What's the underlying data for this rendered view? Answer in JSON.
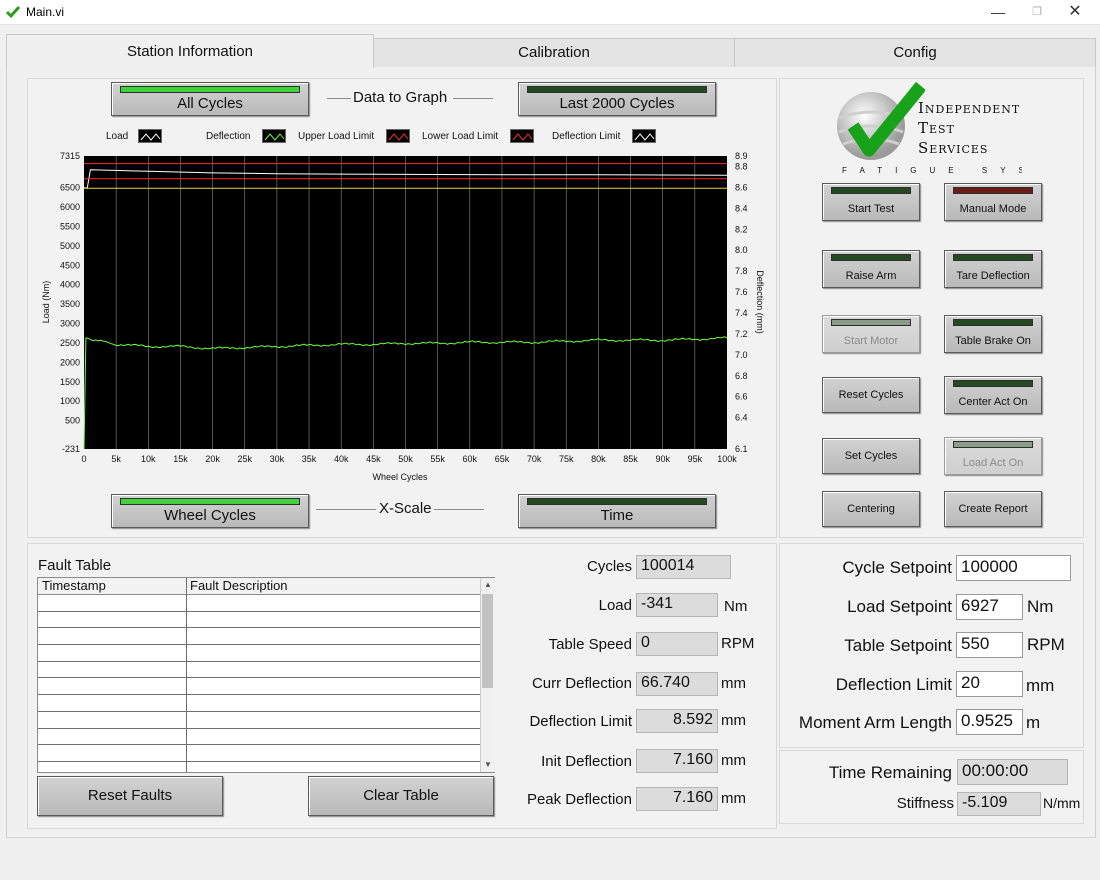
{
  "window": {
    "title": "Main.vi"
  },
  "tabs": [
    "Station Information",
    "Calibration",
    "Config"
  ],
  "graph_controls": {
    "all_cycles": "All Cycles",
    "data_to_graph": "Data to Graph",
    "last_2000": "Last 2000 Cycles",
    "wheel_cycles": "Wheel Cycles",
    "x_scale": "X-Scale",
    "time": "Time"
  },
  "legend": [
    "Load",
    "Deflection",
    "Upper Load Limit",
    "Lower Load Limit",
    "Deflection Limit"
  ],
  "chart_data": {
    "type": "line",
    "xlabel": "Wheel Cycles",
    "ylabel": "Load (Nm)",
    "y2label": "Deflection (mm)",
    "xlim": [
      0,
      100000
    ],
    "ylim": [
      -231,
      7315
    ],
    "y2lim": [
      6.1,
      8.9
    ],
    "x_ticks": [
      "0",
      "5k",
      "10k",
      "15k",
      "20k",
      "25k",
      "30k",
      "35k",
      "40k",
      "45k",
      "50k",
      "55k",
      "60k",
      "65k",
      "70k",
      "75k",
      "80k",
      "85k",
      "90k",
      "95k",
      "100k"
    ],
    "y_ticks": [
      "7315",
      "6500",
      "6000",
      "5500",
      "5000",
      "4500",
      "4000",
      "3500",
      "3000",
      "2500",
      "2000",
      "1500",
      "1000",
      "500",
      "-231"
    ],
    "y2_ticks": [
      "8.9",
      "8.8",
      "8.6",
      "8.4",
      "8.2",
      "8.0",
      "7.8",
      "7.6",
      "7.4",
      "7.2",
      "7.0",
      "6.8",
      "6.6",
      "6.4",
      "6.1"
    ],
    "grid": "vertical",
    "series": [
      {
        "name": "Load",
        "color": "#ffffff",
        "axis": "left",
        "x": [
          0,
          500,
          1000,
          10000,
          20000,
          30000,
          40000,
          50000,
          60000,
          70000,
          80000,
          90000,
          100000
        ],
        "y": [
          6500,
          6480,
          6960,
          6920,
          6880,
          6860,
          6850,
          6840,
          6835,
          6830,
          6830,
          6825,
          6820
        ]
      },
      {
        "name": "Deflection",
        "color": "#6dff3a",
        "axis": "right",
        "x": [
          0,
          300,
          500,
          1000,
          5000,
          10000,
          15000,
          20000,
          25000,
          30000,
          35000,
          40000,
          45000,
          50000,
          55000,
          60000,
          65000,
          70000,
          75000,
          80000,
          85000,
          90000,
          95000,
          100000
        ],
        "y": [
          6.1,
          7.16,
          7.16,
          7.15,
          7.1,
          7.08,
          7.08,
          7.06,
          7.07,
          7.08,
          7.09,
          7.1,
          7.1,
          7.11,
          7.11,
          7.12,
          7.12,
          7.12,
          7.13,
          7.14,
          7.14,
          7.14,
          7.15,
          7.16
        ]
      },
      {
        "name": "Upper Load Limit",
        "color": "#ff2a2a",
        "axis": "left",
        "x": [
          0,
          100000
        ],
        "y": [
          7120,
          7120
        ]
      },
      {
        "name": "Lower Load Limit",
        "color": "#ff2a2a",
        "axis": "left",
        "x": [
          0,
          100000
        ],
        "y": [
          6730,
          6730
        ]
      },
      {
        "name": "Deflection Limit",
        "color": "#e8d23a",
        "axis": "right",
        "x": [
          0,
          100000
        ],
        "y": [
          8.592,
          8.592
        ]
      }
    ]
  },
  "logo": {
    "line1": "Independent",
    "line2": "Test",
    "line3": "Services",
    "tagline": "FATIGUE SYSTEMS"
  },
  "buttons": {
    "start_test": "Start Test",
    "manual_mode": "Manual Mode",
    "raise_arm": "Raise Arm",
    "tare_deflection": "Tare Deflection",
    "start_motor": "Start Motor",
    "table_brake_on": "Table Brake On",
    "reset_cycles": "Reset Cycles",
    "center_act_on": "Center Act On",
    "set_cycles": "Set Cycles",
    "load_act_on": "Load Act On",
    "centering": "Centering",
    "create_report": "Create Report",
    "reset_faults": "Reset Faults",
    "clear_table": "Clear Table"
  },
  "fault_table": {
    "title": "Fault Table",
    "columns": [
      "Timestamp",
      "Fault Description"
    ]
  },
  "indicators": {
    "cycles": {
      "label": "Cycles",
      "value": "100014"
    },
    "load": {
      "label": "Load",
      "value": "-341",
      "unit": "Nm"
    },
    "table_speed": {
      "label": "Table Speed",
      "value": "0",
      "unit": "RPM"
    },
    "curr_deflection": {
      "label": "Curr Deflection",
      "value": "66.740",
      "unit": "mm"
    },
    "deflection_limit": {
      "label": "Deflection Limit",
      "value": "8.592",
      "unit": "mm"
    },
    "init_deflection": {
      "label": "Init Deflection",
      "value": "7.160",
      "unit": "mm"
    },
    "peak_deflection": {
      "label": "Peak Deflection",
      "value": "7.160",
      "unit": "mm"
    }
  },
  "setpoints": {
    "cycle_setpoint": {
      "label": "Cycle Setpoint",
      "value": "100000"
    },
    "load_setpoint": {
      "label": "Load Setpoint",
      "value": "6927",
      "unit": "Nm"
    },
    "table_setpoint": {
      "label": "Table Setpoint",
      "value": "550",
      "unit": "RPM"
    },
    "deflection_limit": {
      "label": "Deflection Limit",
      "value": "20",
      "unit": "mm"
    },
    "moment_arm": {
      "label": "Moment Arm Length",
      "value": "0.9525",
      "unit": "m"
    }
  },
  "status": {
    "time_remaining": {
      "label": "Time Remaining",
      "value": "00:00:00"
    },
    "stiffness": {
      "label": "Stiffness",
      "value": "-5.109",
      "unit": "N/mm"
    }
  }
}
